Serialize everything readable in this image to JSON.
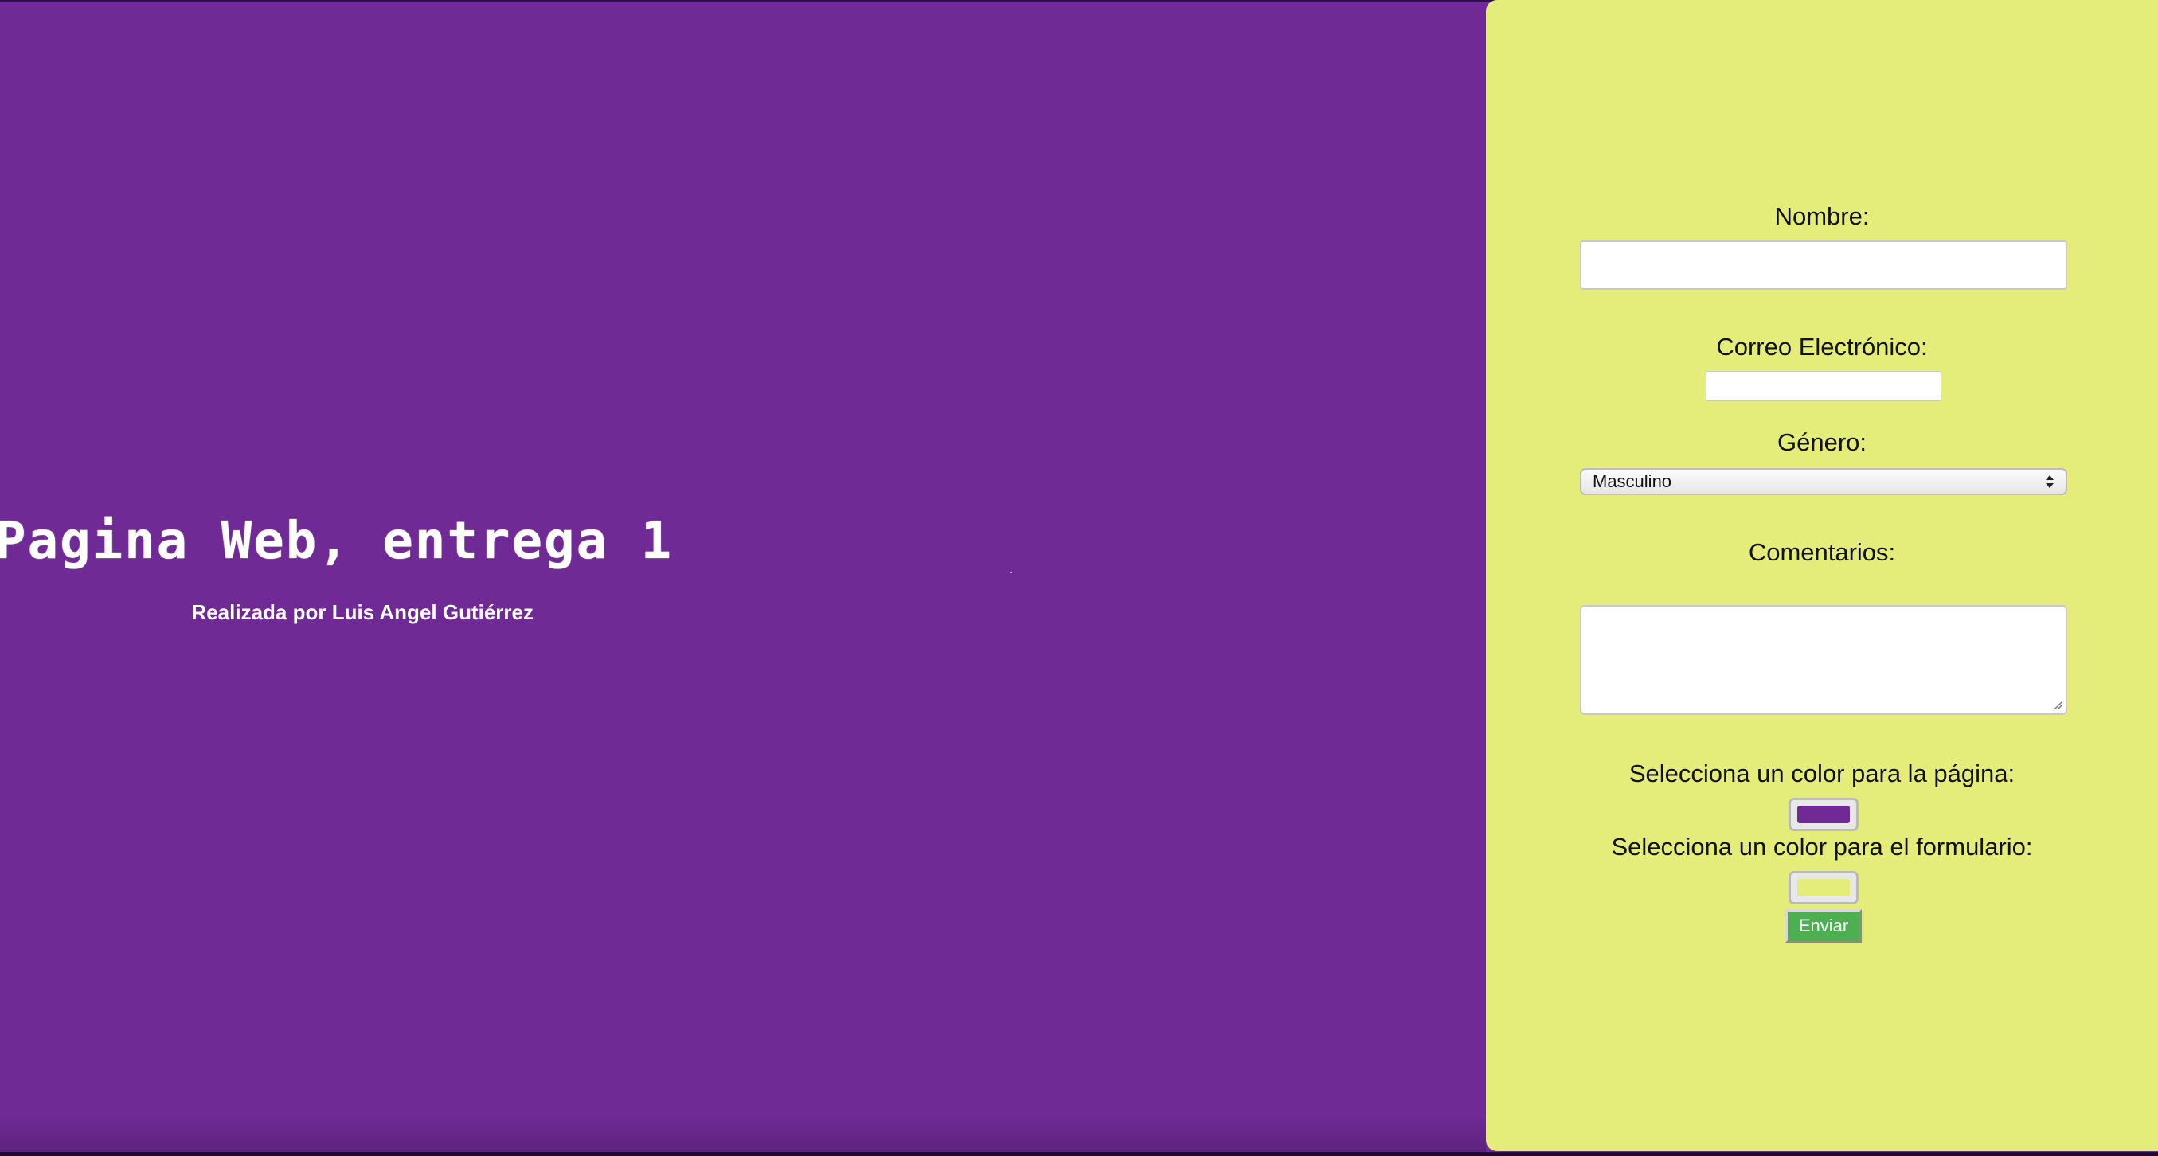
{
  "hero": {
    "title": "Pagina Web, entrega 1",
    "subtitle": "Realizada por Luis Angel Gutiérrez"
  },
  "form": {
    "name_label": "Nombre:",
    "name_value": "",
    "email_label": "Correo Electrónico:",
    "email_value": "",
    "gender_label": "Género:",
    "gender_selected": "Masculino",
    "comments_label": "Comentarios:",
    "comments_value": "",
    "page_color_label": "Selecciona un color para la página:",
    "page_color_value": "#6f2a96",
    "form_color_label": "Selecciona un color para el formulario:",
    "form_color_value": "#e5ed7a",
    "submit_label": "Enviar"
  },
  "colors": {
    "page_background": "#6f2a96",
    "form_background": "#e5ed7a",
    "submit_button": "#4caf50"
  }
}
